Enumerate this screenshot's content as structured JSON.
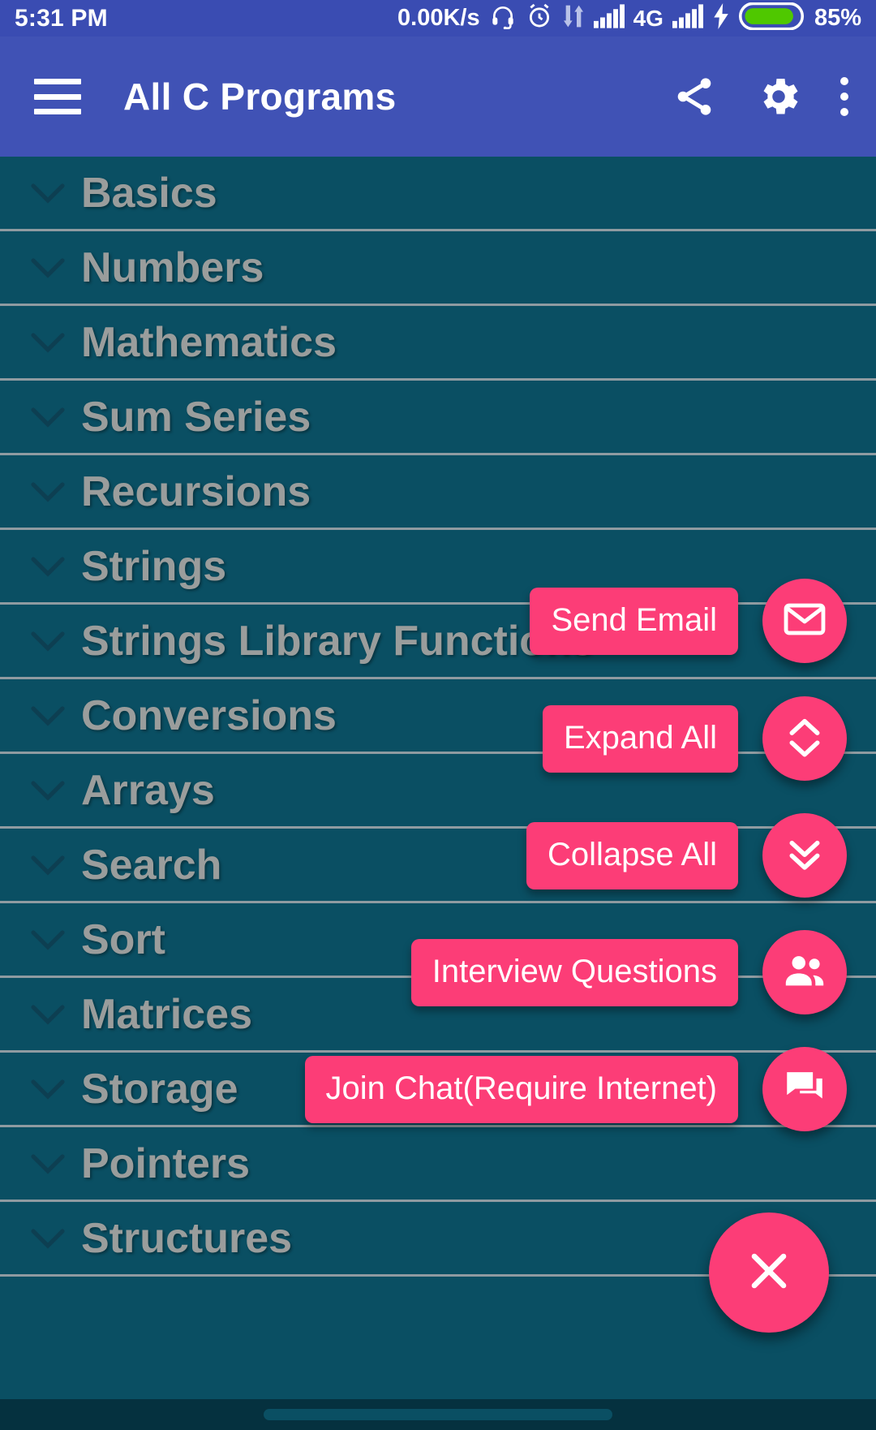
{
  "statusbar": {
    "time": "5:31 PM",
    "network_speed": "0.00K/s",
    "network_type": "4G",
    "battery_percent": "85%",
    "icons": [
      "headphone-icon",
      "alarm-icon",
      "data-transfer-icon",
      "signal-icon",
      "signal-icon",
      "charging-bolt-icon",
      "battery-icon"
    ],
    "colors": {
      "background": "#3a4cb2",
      "battery_fill": "#4fc800",
      "foreground": "#ffffff"
    }
  },
  "appbar": {
    "menu_icon": "hamburger-menu-icon",
    "title": "All C Programs",
    "actions": [
      {
        "name": "share-icon",
        "label": "Share"
      },
      {
        "name": "gear-icon",
        "label": "Settings"
      },
      {
        "name": "overflow-menu-icon",
        "label": "More options"
      }
    ],
    "colors": {
      "background": "#4052b5",
      "foreground": "#ffffff"
    }
  },
  "list": {
    "expand_icon": "chevron-down-icon",
    "items": [
      {
        "label": "Basics"
      },
      {
        "label": "Numbers"
      },
      {
        "label": "Mathematics"
      },
      {
        "label": "Sum Series"
      },
      {
        "label": "Recursions"
      },
      {
        "label": "Strings"
      },
      {
        "label": "Strings Library Functions"
      },
      {
        "label": "Conversions"
      },
      {
        "label": "Arrays"
      },
      {
        "label": "Search"
      },
      {
        "label": "Sort"
      },
      {
        "label": "Matrices"
      },
      {
        "label": "Storage"
      },
      {
        "label": "Pointers"
      },
      {
        "label": "Structures"
      }
    ],
    "colors": {
      "background": "#0a4f63",
      "text": "#9a9d9c",
      "divider": "#8f9ba1"
    }
  },
  "speed_dial": {
    "open": true,
    "accent_color": "#fc3d77",
    "label_text_color": "#ffffff",
    "items": [
      {
        "label": "Send Email",
        "icon": "envelope-icon"
      },
      {
        "label": "Expand All",
        "icon": "expand-vertical-chevrons-icon"
      },
      {
        "label": "Collapse All",
        "icon": "double-chevron-down-icon"
      },
      {
        "label": "Interview Questions",
        "icon": "people-icon"
      },
      {
        "label": "Join Chat(Require Internet)",
        "icon": "chat-bubble-icon"
      }
    ],
    "close_button": {
      "icon": "close-x-icon",
      "label": "Close menu"
    }
  }
}
